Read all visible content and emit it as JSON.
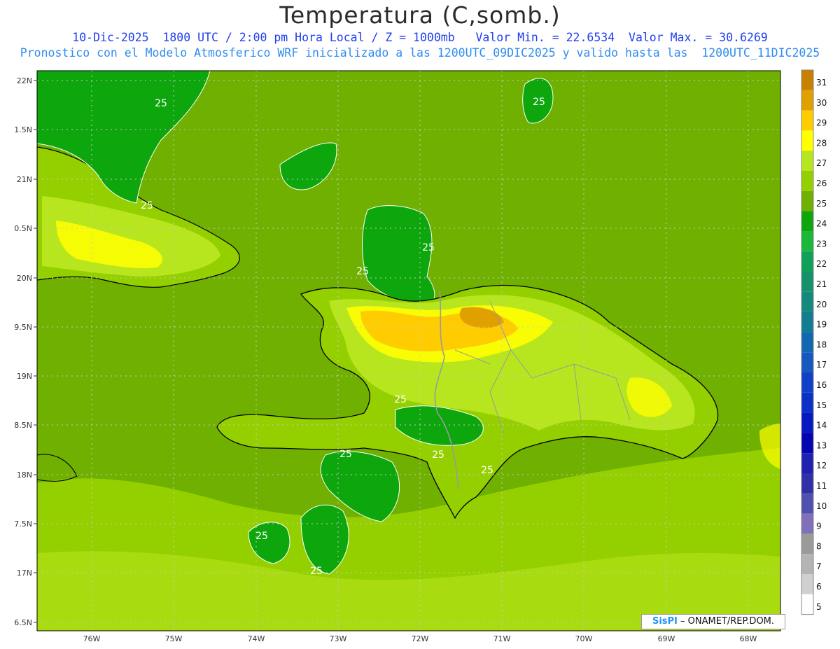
{
  "header": {
    "title": "Temperatura (C,somb.)",
    "subtitle_line1": "10-Dic-2025  1800 UTC / 2:00 pm Hora Local / Z = 1000mb   Valor Min. = 22.6534  Valor Max. = 30.6269",
    "subtitle_line2": "Pronostico con el Modelo Atmosferico WRF inicializado a las 1200UTC_09DIC2025 y valido hasta las  1200UTC_11DIC2025"
  },
  "map": {
    "lat_labels": [
      "22N",
      "1.5N",
      "21N",
      "0.5N",
      "20N",
      "9.5N",
      "19N",
      "8.5N",
      "18N",
      "7.5N",
      "17N",
      "6.5N"
    ],
    "lon_labels": [
      "76W",
      "75W",
      "74W",
      "73W",
      "72W",
      "71W",
      "70W",
      "69W",
      "68W"
    ],
    "contour_labels": [
      "25",
      "25",
      "25",
      "25",
      "25",
      "25",
      "25",
      "25",
      "25",
      "25",
      "25"
    ],
    "colors": {
      "t24": "#0da60d",
      "t25": "#6fb000",
      "t26": "#94d000",
      "t27": "#b8e61e",
      "t28": "#ffff00",
      "t29": "#ffcc00",
      "t30": "#e0a000",
      "t31": "#c88000",
      "coast": "#000000",
      "border": "#9a9a9a",
      "contour": "#ffffff"
    }
  },
  "colorbar": {
    "labels": [
      "31",
      "30",
      "29",
      "28",
      "27",
      "26",
      "25",
      "24",
      "23",
      "22",
      "21",
      "20",
      "19",
      "18",
      "17",
      "16",
      "15",
      "14",
      "13",
      "12",
      "11",
      "10",
      "9",
      "8",
      "7",
      "6",
      "5"
    ],
    "colors": [
      "#c88000",
      "#e0a000",
      "#ffcc00",
      "#ffff00",
      "#b8e61e",
      "#94d000",
      "#6fb000",
      "#0da60d",
      "#1bb83a",
      "#10a05a",
      "#15926a",
      "#148a7e",
      "#127d90",
      "#1068b0",
      "#1458c0",
      "#1040c8",
      "#0a30c8",
      "#0818c0",
      "#0404b0",
      "#2020b0",
      "#3030a8",
      "#5050b0",
      "#8070b8",
      "#9a9a9a",
      "#b4b4b4",
      "#d0d0d0",
      "#ffffff"
    ]
  },
  "credit": {
    "brand": "SisPI",
    "text": " – ONAMET/REP.DOM."
  }
}
